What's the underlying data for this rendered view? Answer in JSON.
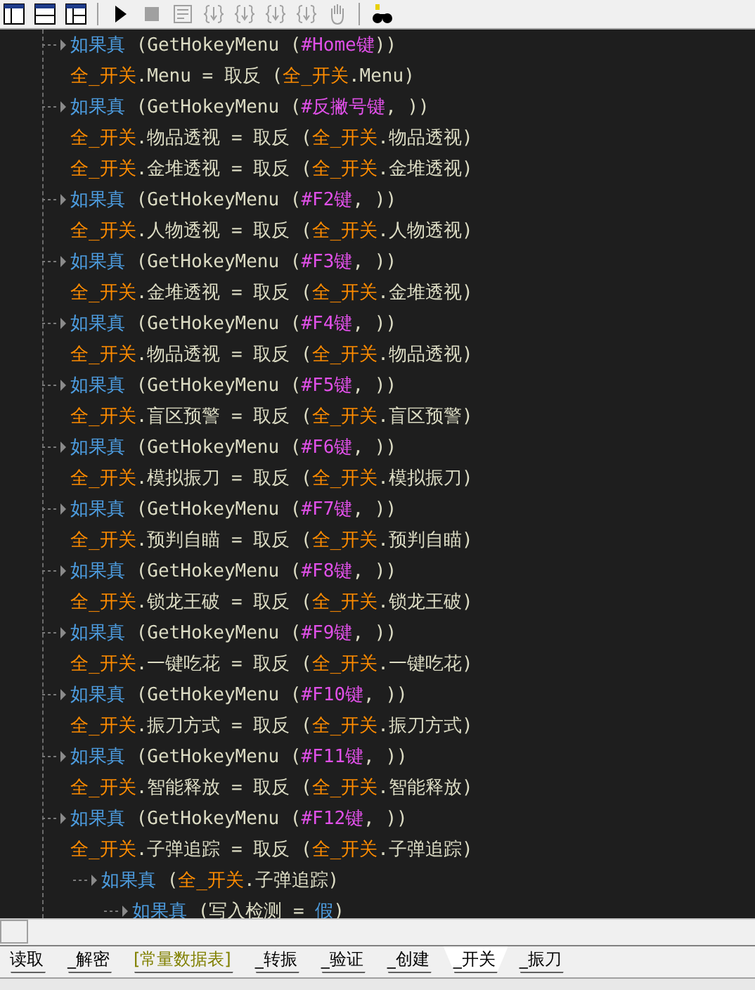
{
  "toolbar": {
    "buttons": [
      {
        "kind": "layout-a",
        "disabled": false
      },
      {
        "kind": "layout-b",
        "disabled": false
      },
      {
        "kind": "layout-c",
        "disabled": false
      },
      {
        "kind": "run",
        "disabled": false
      },
      {
        "kind": "stop",
        "disabled": true
      },
      {
        "kind": "step",
        "disabled": true
      },
      {
        "kind": "brace-in",
        "disabled": true
      },
      {
        "kind": "brace-over",
        "disabled": true
      },
      {
        "kind": "brace-out",
        "disabled": true
      },
      {
        "kind": "brace-back",
        "disabled": true
      },
      {
        "kind": "hand",
        "disabled": true
      },
      {
        "kind": "find",
        "disabled": false
      }
    ]
  },
  "code": [
    {
      "kind": "if",
      "tokens": [
        {
          "kind": "kw",
          "t": "如果真"
        },
        {
          "kind": "plain",
          "t": " (GetHokeyMenu ("
        },
        {
          "kind": "const",
          "t": "#Home键"
        },
        {
          "kind": "plain",
          "t": "))"
        }
      ],
      "children": [
        {
          "kind": "assign",
          "tokens": [
            {
              "kind": "var",
              "t": "全_开关"
            },
            {
              "kind": "plain",
              "t": ".Menu = 取反 ("
            },
            {
              "kind": "var",
              "t": "全_开关"
            },
            {
              "kind": "plain",
              "t": ".Menu)"
            }
          ]
        }
      ]
    },
    {
      "kind": "if",
      "tokens": [
        {
          "kind": "kw",
          "t": "如果真"
        },
        {
          "kind": "plain",
          "t": " (GetHokeyMenu ("
        },
        {
          "kind": "const",
          "t": "#反撇号键"
        },
        {
          "kind": "plain",
          "t": ", ))"
        }
      ],
      "children": [
        {
          "kind": "assign",
          "tokens": [
            {
              "kind": "var",
              "t": "全_开关"
            },
            {
              "kind": "plain",
              "t": ".物品透视 = 取反 ("
            },
            {
              "kind": "var",
              "t": "全_开关"
            },
            {
              "kind": "plain",
              "t": ".物品透视)"
            }
          ]
        },
        {
          "kind": "assign",
          "tokens": [
            {
              "kind": "var",
              "t": "全_开关"
            },
            {
              "kind": "plain",
              "t": ".金堆透视 = 取反 ("
            },
            {
              "kind": "var",
              "t": "全_开关"
            },
            {
              "kind": "plain",
              "t": ".金堆透视)"
            }
          ]
        }
      ]
    },
    {
      "kind": "if",
      "tokens": [
        {
          "kind": "kw",
          "t": "如果真"
        },
        {
          "kind": "plain",
          "t": " (GetHokeyMenu ("
        },
        {
          "kind": "const",
          "t": "#F2键"
        },
        {
          "kind": "plain",
          "t": ", ))"
        }
      ],
      "children": [
        {
          "kind": "assign",
          "tokens": [
            {
              "kind": "var",
              "t": "全_开关"
            },
            {
              "kind": "plain",
              "t": ".人物透视 = 取反 ("
            },
            {
              "kind": "var",
              "t": "全_开关"
            },
            {
              "kind": "plain",
              "t": ".人物透视)"
            }
          ]
        }
      ]
    },
    {
      "kind": "if",
      "tokens": [
        {
          "kind": "kw",
          "t": "如果真"
        },
        {
          "kind": "plain",
          "t": " (GetHokeyMenu ("
        },
        {
          "kind": "const",
          "t": "#F3键"
        },
        {
          "kind": "plain",
          "t": ", ))"
        }
      ],
      "children": [
        {
          "kind": "assign",
          "tokens": [
            {
              "kind": "var",
              "t": "全_开关"
            },
            {
              "kind": "plain",
              "t": ".金堆透视 = 取反 ("
            },
            {
              "kind": "var",
              "t": "全_开关"
            },
            {
              "kind": "plain",
              "t": ".金堆透视)"
            }
          ]
        }
      ]
    },
    {
      "kind": "if",
      "tokens": [
        {
          "kind": "kw",
          "t": "如果真"
        },
        {
          "kind": "plain",
          "t": " (GetHokeyMenu ("
        },
        {
          "kind": "const",
          "t": "#F4键"
        },
        {
          "kind": "plain",
          "t": ", ))"
        }
      ],
      "children": [
        {
          "kind": "assign",
          "tokens": [
            {
              "kind": "var",
              "t": "全_开关"
            },
            {
              "kind": "plain",
              "t": ".物品透视 = 取反 ("
            },
            {
              "kind": "var",
              "t": "全_开关"
            },
            {
              "kind": "plain",
              "t": ".物品透视)"
            }
          ]
        }
      ]
    },
    {
      "kind": "if",
      "tokens": [
        {
          "kind": "kw",
          "t": "如果真"
        },
        {
          "kind": "plain",
          "t": " (GetHokeyMenu ("
        },
        {
          "kind": "const",
          "t": "#F5键"
        },
        {
          "kind": "plain",
          "t": ", ))"
        }
      ],
      "children": [
        {
          "kind": "assign",
          "tokens": [
            {
              "kind": "var",
              "t": "全_开关"
            },
            {
              "kind": "plain",
              "t": ".盲区预警 = 取反 ("
            },
            {
              "kind": "var",
              "t": "全_开关"
            },
            {
              "kind": "plain",
              "t": ".盲区预警)"
            }
          ]
        }
      ]
    },
    {
      "kind": "if",
      "tokens": [
        {
          "kind": "kw",
          "t": "如果真"
        },
        {
          "kind": "plain",
          "t": " (GetHokeyMenu ("
        },
        {
          "kind": "const",
          "t": "#F6键"
        },
        {
          "kind": "plain",
          "t": ", ))"
        }
      ],
      "children": [
        {
          "kind": "assign",
          "tokens": [
            {
              "kind": "var",
              "t": "全_开关"
            },
            {
              "kind": "plain",
              "t": ".模拟振刀 = 取反 ("
            },
            {
              "kind": "var",
              "t": "全_开关"
            },
            {
              "kind": "plain",
              "t": ".模拟振刀)"
            }
          ]
        }
      ]
    },
    {
      "kind": "if",
      "tokens": [
        {
          "kind": "kw",
          "t": "如果真"
        },
        {
          "kind": "plain",
          "t": " (GetHokeyMenu ("
        },
        {
          "kind": "const",
          "t": "#F7键"
        },
        {
          "kind": "plain",
          "t": ", ))"
        }
      ],
      "children": [
        {
          "kind": "assign",
          "tokens": [
            {
              "kind": "var",
              "t": "全_开关"
            },
            {
              "kind": "plain",
              "t": ".预判自瞄 = 取反 ("
            },
            {
              "kind": "var",
              "t": "全_开关"
            },
            {
              "kind": "plain",
              "t": ".预判自瞄)"
            }
          ]
        }
      ]
    },
    {
      "kind": "if",
      "tokens": [
        {
          "kind": "kw",
          "t": "如果真"
        },
        {
          "kind": "plain",
          "t": " (GetHokeyMenu ("
        },
        {
          "kind": "const",
          "t": "#F8键"
        },
        {
          "kind": "plain",
          "t": ", ))"
        }
      ],
      "children": [
        {
          "kind": "assign",
          "tokens": [
            {
              "kind": "var",
              "t": "全_开关"
            },
            {
              "kind": "plain",
              "t": ".锁龙王破 = 取反 ("
            },
            {
              "kind": "var",
              "t": "全_开关"
            },
            {
              "kind": "plain",
              "t": ".锁龙王破)"
            }
          ]
        }
      ]
    },
    {
      "kind": "if",
      "tokens": [
        {
          "kind": "kw",
          "t": "如果真"
        },
        {
          "kind": "plain",
          "t": " (GetHokeyMenu ("
        },
        {
          "kind": "const",
          "t": "#F9键"
        },
        {
          "kind": "plain",
          "t": ", ))"
        }
      ],
      "children": [
        {
          "kind": "assign",
          "tokens": [
            {
              "kind": "var",
              "t": "全_开关"
            },
            {
              "kind": "plain",
              "t": ".一键吃花 = 取反 ("
            },
            {
              "kind": "var",
              "t": "全_开关"
            },
            {
              "kind": "plain",
              "t": ".一键吃花)"
            }
          ]
        }
      ]
    },
    {
      "kind": "if",
      "tokens": [
        {
          "kind": "kw",
          "t": "如果真"
        },
        {
          "kind": "plain",
          "t": " (GetHokeyMenu ("
        },
        {
          "kind": "const",
          "t": "#F10键"
        },
        {
          "kind": "plain",
          "t": ", ))"
        }
      ],
      "children": [
        {
          "kind": "assign",
          "tokens": [
            {
              "kind": "var",
              "t": "全_开关"
            },
            {
              "kind": "plain",
              "t": ".振刀方式 = 取反 ("
            },
            {
              "kind": "var",
              "t": "全_开关"
            },
            {
              "kind": "plain",
              "t": ".振刀方式)"
            }
          ]
        }
      ]
    },
    {
      "kind": "if",
      "tokens": [
        {
          "kind": "kw",
          "t": "如果真"
        },
        {
          "kind": "plain",
          "t": " (GetHokeyMenu ("
        },
        {
          "kind": "const",
          "t": "#F11键"
        },
        {
          "kind": "plain",
          "t": ", ))"
        }
      ],
      "children": [
        {
          "kind": "assign",
          "tokens": [
            {
              "kind": "var",
              "t": "全_开关"
            },
            {
              "kind": "plain",
              "t": ".智能释放 = 取反 ("
            },
            {
              "kind": "var",
              "t": "全_开关"
            },
            {
              "kind": "plain",
              "t": ".智能释放)"
            }
          ]
        }
      ]
    },
    {
      "kind": "if",
      "tokens": [
        {
          "kind": "kw",
          "t": "如果真"
        },
        {
          "kind": "plain",
          "t": " (GetHokeyMenu ("
        },
        {
          "kind": "const",
          "t": "#F12键"
        },
        {
          "kind": "plain",
          "t": ", ))"
        }
      ],
      "children": [
        {
          "kind": "assign",
          "tokens": [
            {
              "kind": "var",
              "t": "全_开关"
            },
            {
              "kind": "plain",
              "t": ".子弹追踪 = 取反 ("
            },
            {
              "kind": "var",
              "t": "全_开关"
            },
            {
              "kind": "plain",
              "t": ".子弹追踪)"
            }
          ]
        },
        {
          "kind": "if",
          "tokens": [
            {
              "kind": "kw",
              "t": "如果真"
            },
            {
              "kind": "plain",
              "t": " ("
            },
            {
              "kind": "var",
              "t": "全_开关"
            },
            {
              "kind": "plain",
              "t": ".子弹追踪)"
            }
          ],
          "children": [
            {
              "kind": "if",
              "tokens": [
                {
                  "kind": "kw",
                  "t": "如果真"
                },
                {
                  "kind": "plain",
                  "t": " (写入检测 = "
                },
                {
                  "kind": "kw",
                  "t": "假"
                },
                {
                  "kind": "plain",
                  "t": ")"
                }
              ]
            }
          ]
        }
      ]
    }
  ],
  "tabs": [
    {
      "label": "读取",
      "selected": false,
      "kind": "normal"
    },
    {
      "label": "_解密",
      "selected": false,
      "kind": "normal"
    },
    {
      "label": "[常量数据表]",
      "selected": false,
      "kind": "data"
    },
    {
      "label": "_转振",
      "selected": false,
      "kind": "normal"
    },
    {
      "label": "_验证",
      "selected": false,
      "kind": "normal"
    },
    {
      "label": "_创建",
      "selected": false,
      "kind": "normal"
    },
    {
      "label": "_开关",
      "selected": true,
      "kind": "normal"
    },
    {
      "label": "_振刀",
      "selected": false,
      "kind": "normal"
    }
  ]
}
